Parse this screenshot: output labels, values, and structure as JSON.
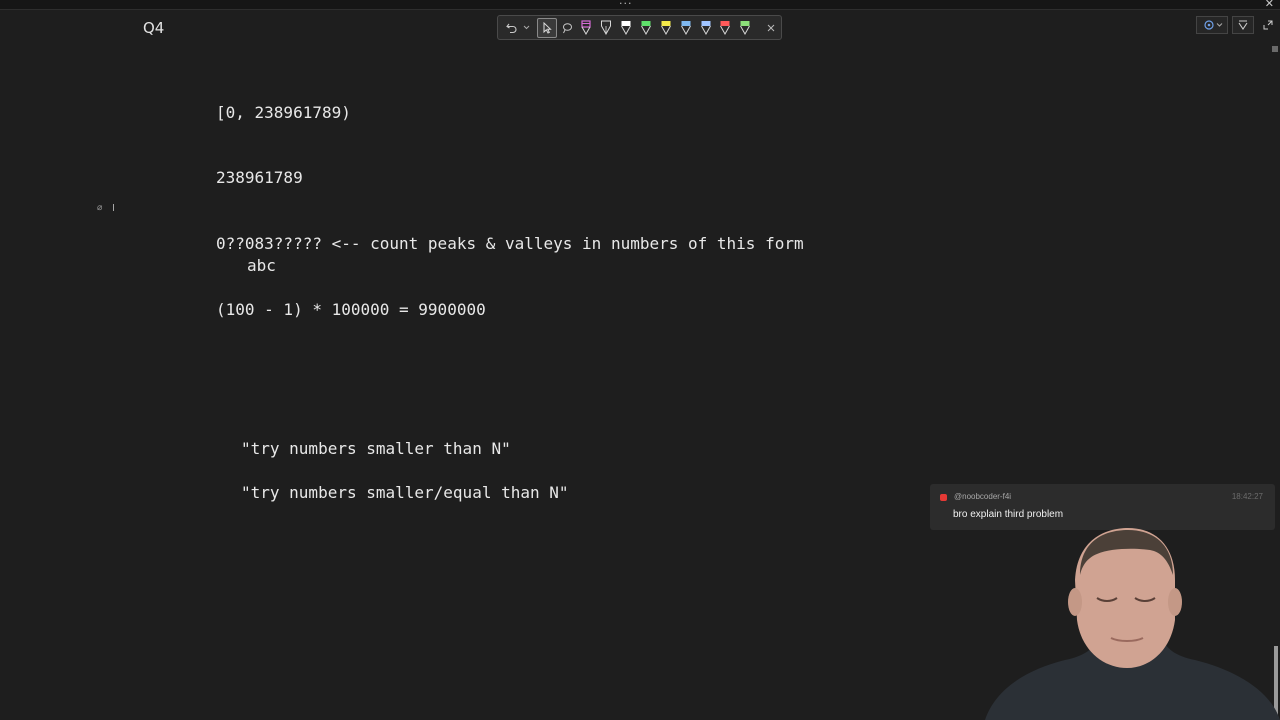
{
  "window": {
    "drag_handle": "···",
    "close_glyph": "✕"
  },
  "page": {
    "title": "Q4"
  },
  "toolbar": {
    "pen_colors": [
      "#d76bd8",
      "#d8d8d8",
      "#ffffff",
      "#5fe06b",
      "#f4e94a",
      "#7fb8f0",
      "#a0c4ff",
      "#ff5a5a",
      "#8ce07a"
    ]
  },
  "editor": {
    "paragraph_mark": "⌀",
    "caret": "I"
  },
  "notes": {
    "line_range": "[0, 238961789)",
    "line_number": "238961789",
    "line_pattern": "0??083????? <-- count peaks & valleys in numbers of this form",
    "line_abc": "abc",
    "line_equation": "(100 - 1) * 100000 = 9900000",
    "line_try_smaller": "\"try numbers smaller than N\"",
    "line_try_smaller_equal": "\"try numbers smaller/equal than N\""
  },
  "chat": {
    "username": "@noobcoder-f4i",
    "timestamp": "18:42:27",
    "message": "bro explain third problem",
    "platform_color": "#e53935"
  },
  "theme": {
    "background": "#1e1e1e",
    "text": "#e8e8e8"
  }
}
